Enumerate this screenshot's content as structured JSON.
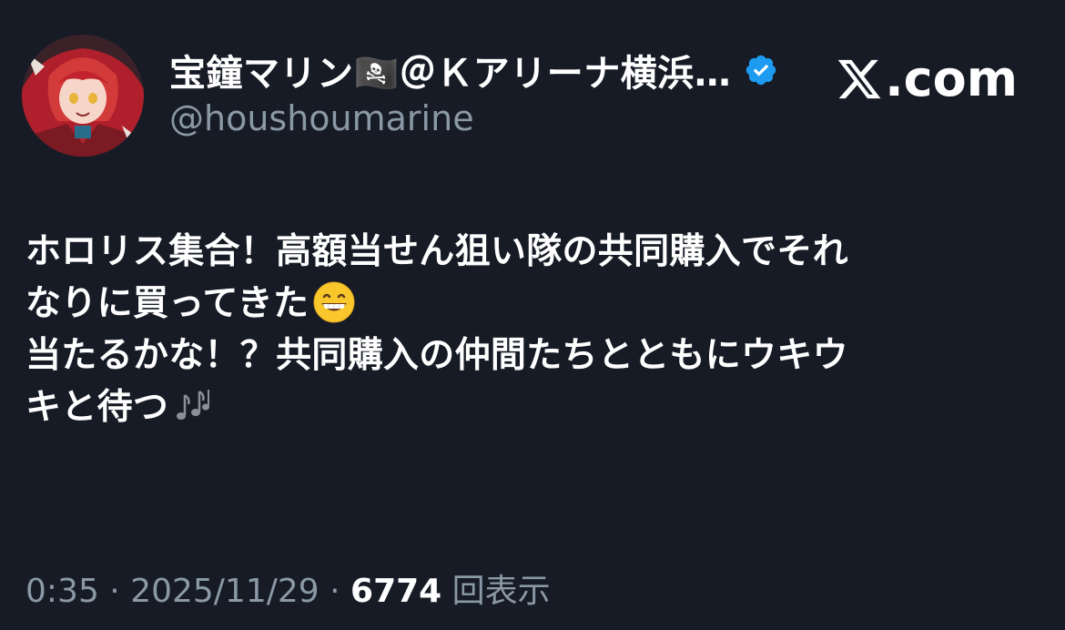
{
  "author": {
    "display_name": "宝鐘マリン🏴‍☠️＠Ｋアリーナ横浜…",
    "handle": "@houshoumarine",
    "verified": true
  },
  "brand": {
    "label": ".com",
    "accent": "#1d9bf0"
  },
  "tweet": {
    "lines": [
      "ホロリス集合！高額当せん狙い隊の共同購入でそれ",
      "なりに買ってきた",
      "当たるかな！？共同購入の仲間たちとともにウキウ",
      "キと待つ"
    ]
  },
  "meta": {
    "time": "0:35",
    "separator": " · ",
    "date": "2025/11/29",
    "views_count": "6774",
    "views_label": " 回表示"
  },
  "colors": {
    "background": "#161b25",
    "muted_text": "#8b98a5",
    "text": "#ffffff"
  },
  "icons": {
    "verified": "verified-badge-icon",
    "emoji_1": "grinning-face-icon",
    "emoji_2": "musical-notes-icon",
    "brand": "x-logo-icon"
  }
}
